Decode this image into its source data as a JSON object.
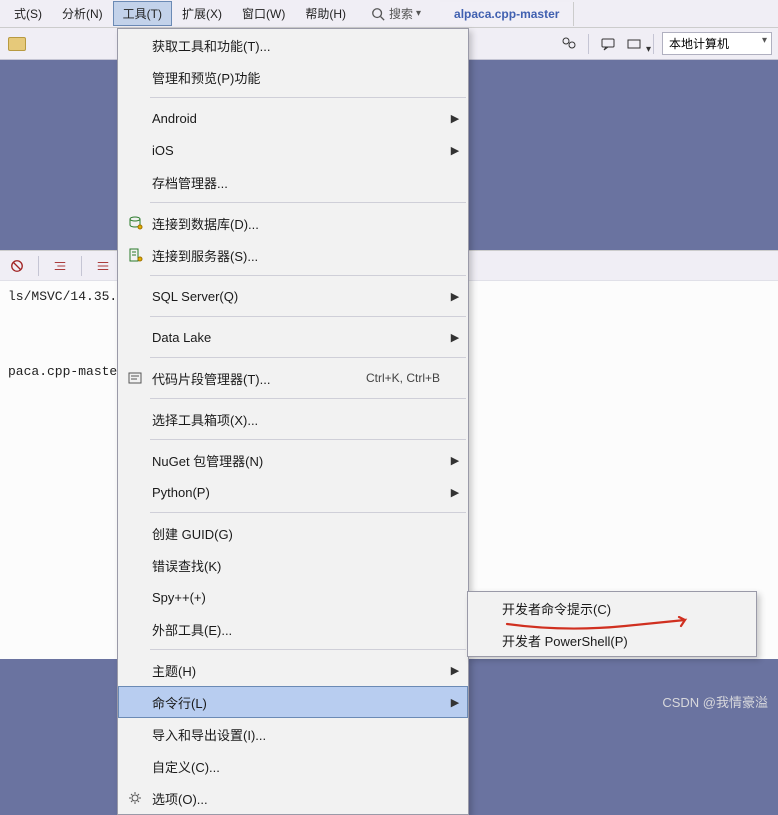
{
  "menubar": {
    "items": [
      {
        "label": "式(S)"
      },
      {
        "label": "分析(N)"
      },
      {
        "label": "工具(T)"
      },
      {
        "label": "扩展(X)"
      },
      {
        "label": "窗口(W)"
      },
      {
        "label": "帮助(H)"
      }
    ],
    "search_label": "搜索"
  },
  "tab": {
    "title": "alpaca.cpp-master"
  },
  "toolbar": {
    "target": "本地计算机"
  },
  "editor": {
    "line1": "ls/MSVC/14.35.",
    "line2": "paca.cpp-master"
  },
  "tools_menu": {
    "items": [
      {
        "label": "获取工具和功能(T)...",
        "icon": null,
        "shortcut": "",
        "arrow": false
      },
      {
        "label": "管理和预览(P)功能",
        "icon": null,
        "shortcut": "",
        "arrow": false
      },
      {
        "sep": true
      },
      {
        "label": "Android",
        "icon": null,
        "shortcut": "",
        "arrow": true
      },
      {
        "label": "iOS",
        "icon": null,
        "shortcut": "",
        "arrow": true
      },
      {
        "label": "存档管理器...",
        "icon": null,
        "shortcut": "",
        "arrow": false
      },
      {
        "sep": true
      },
      {
        "label": "连接到数据库(D)...",
        "icon": "db",
        "shortcut": "",
        "arrow": false
      },
      {
        "label": "连接到服务器(S)...",
        "icon": "server",
        "shortcut": "",
        "arrow": false
      },
      {
        "sep": true
      },
      {
        "label": "SQL Server(Q)",
        "icon": null,
        "shortcut": "",
        "arrow": true
      },
      {
        "sep": true
      },
      {
        "label": "Data Lake",
        "icon": null,
        "shortcut": "",
        "arrow": true
      },
      {
        "sep": true
      },
      {
        "label": "代码片段管理器(T)...",
        "icon": "snippet",
        "shortcut": "Ctrl+K, Ctrl+B",
        "arrow": false
      },
      {
        "sep": true
      },
      {
        "label": "选择工具箱项(X)...",
        "icon": null,
        "shortcut": "",
        "arrow": false
      },
      {
        "sep": true
      },
      {
        "label": "NuGet 包管理器(N)",
        "icon": null,
        "shortcut": "",
        "arrow": true
      },
      {
        "label": "Python(P)",
        "icon": null,
        "shortcut": "",
        "arrow": true
      },
      {
        "sep": true
      },
      {
        "label": "创建 GUID(G)",
        "icon": null,
        "shortcut": "",
        "arrow": false
      },
      {
        "label": "错误查找(K)",
        "icon": null,
        "shortcut": "",
        "arrow": false
      },
      {
        "label": "Spy++(+)",
        "icon": null,
        "shortcut": "",
        "arrow": false
      },
      {
        "label": "外部工具(E)...",
        "icon": null,
        "shortcut": "",
        "arrow": false
      },
      {
        "sep": true
      },
      {
        "label": "主题(H)",
        "icon": null,
        "shortcut": "",
        "arrow": true
      },
      {
        "label": "命令行(L)",
        "icon": null,
        "shortcut": "",
        "arrow": true,
        "highlighted": true
      },
      {
        "label": "导入和导出设置(I)...",
        "icon": null,
        "shortcut": "",
        "arrow": false
      },
      {
        "label": "自定义(C)...",
        "icon": null,
        "shortcut": "",
        "arrow": false
      },
      {
        "label": "选项(O)...",
        "icon": "gear",
        "shortcut": "",
        "arrow": false
      }
    ]
  },
  "submenu": {
    "items": [
      {
        "label": "开发者命令提示(C)"
      },
      {
        "label": "开发者 PowerShell(P)"
      }
    ]
  },
  "watermark": "CSDN @我情豪溢"
}
